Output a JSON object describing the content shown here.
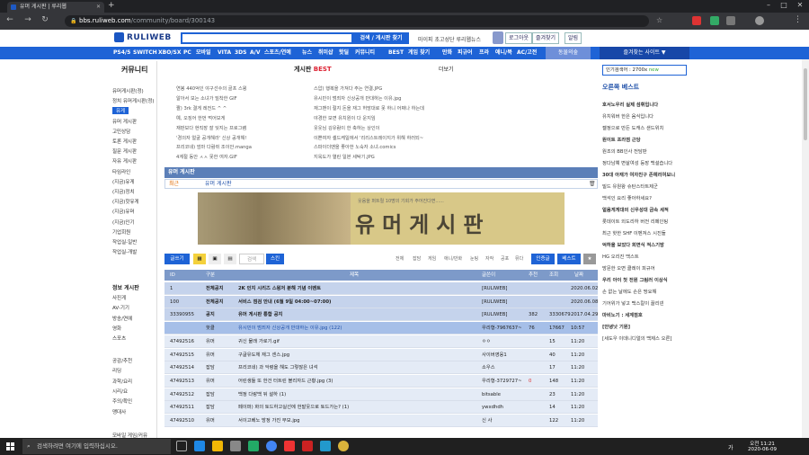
{
  "browser": {
    "tab_title": "유머 게시판 | 루리웹",
    "url_host": "bbs.ruliweb.com",
    "url_path": "/community/board/300143"
  },
  "header": {
    "logo": "RULIWEB",
    "search_button": "검색 / 게시판 찾기",
    "user_links": "마이피  초고성단  루리웹뉴스",
    "login_button": "로그아웃",
    "fav_button": "즐겨찾기",
    "alert_button": "알림"
  },
  "nav": {
    "items": [
      "PS4/5",
      "SWITCH",
      "XBO/SX",
      "PC",
      "모바일",
      "VITA",
      "3DS",
      "A/V",
      "스포츠/연예",
      "뉴스",
      "취미샵",
      "핫딜",
      "커뮤니티",
      "BEST",
      "게임 찾기",
      "만화",
      "피규어",
      "프라",
      "애니/북",
      "AC/고전"
    ],
    "game_button": "동물의숲",
    "fav_site": "즐겨찾는 사이트 ▼"
  },
  "left": {
    "title": "커뮤니티",
    "items": [
      "유머게시판(정)",
      "정치 유머게시판(정)",
      "유게",
      "유머 게시판",
      "고민상담",
      "토론 게시판",
      "질문 게시판",
      "자유 게시판",
      "타임라인",
      "(지금)유게",
      "(지금)정치",
      "(지금)핫유게",
      "(지금)유머",
      "(지금)인기",
      "기업회원",
      "작업실-일반",
      "작업실-개발"
    ],
    "section2": "정보 게시판",
    "items2": [
      "사진게",
      "AV-기기",
      "방송/연예",
      "영화",
      "스포츠"
    ],
    "items3": [
      "공감/추천",
      "리딩",
      "과학/요리",
      "시리/요",
      "주의/확인",
      "맹대사"
    ],
    "bottom": "모바일 게임/커뮤"
  },
  "best": {
    "title_prefix": "게시판",
    "title_best": "BEST",
    "more": "더보기",
    "col1": [
      "연봉 440억인 야구선수의 골프 스윙",
      "알아서 보는 소녀가 밀착한 GIF",
      "짤) 3rk 결게 레전드 ^ ^",
      "예, 오징어 한번 먹어보게",
      "재판보다 현직장 잘 잊지는 프로그램",
      "'경의자 얼굴 공개해라' 신상 공개해!",
      "프리코네) 엄마 다람쥐 조이안.manga",
      "4계절 동안 ㅅㅅ 못한 여자.GIF"
    ],
    "col2": [
      "스압) 행복을 가져다 주는 연결.JPG",
      "유시민이 범죄자 신상공개 반대하는 이유.jpg",
      "재그밴이 절지 돈을 재그 허망대로 못 하니 어쩌나 하는데",
      "야경한 보면 유치원이 다 운지임",
      "웃웃님 김유람이 한 축하는 상인이",
      "이쁜여자 셀드케일에서 '리리스트레이지가 위해 하러되~",
      "스파이더맨을 좋아한 노숙자 소녀.comics",
      "지옥도가 열린 일본 세탁기.JPG"
    ]
  },
  "board": {
    "title": "유머 게시판",
    "recent_label": "최근",
    "recent_item": "유머 게시판",
    "banner_text": "유머게시판",
    "banner_sub": "웃음을 퍼트릴 10명의 기회가 주어진다면......",
    "toolbar": {
      "write": "글쓰기",
      "search_placeholder": "검색",
      "search_btn": "스킨",
      "filters": [
        "전체",
        "잡담",
        "게임",
        "애니/만화",
        "눈팅",
        "자작",
        "공포",
        "뮤다"
      ],
      "hot": "인증글",
      "best": "베스트"
    },
    "columns": [
      "ID",
      "구분",
      "제목",
      "글쓴이",
      "추천",
      "조회",
      "날짜"
    ],
    "rows": [
      {
        "id": "1",
        "cat": "전체공지",
        "title": "2K 인지 시리즈 스윙저 분해 기념 이벤트",
        "author": "[RULIWEB]",
        "rec": "",
        "views": "",
        "date": "2020.06.02",
        "type": "notice"
      },
      {
        "id": "100",
        "cat": "전체공지",
        "title": "서비스 점검 안내 (6월 9일 04:00~07:00)",
        "author": "[RULIWEB]",
        "rec": "",
        "views": "",
        "date": "2020.06.08",
        "type": "notice"
      },
      {
        "id": "33390955",
        "cat": "공지",
        "title": "유머 게시판 통합 공지",
        "author": "[RULIWEB]",
        "rec": "382",
        "views": "3330679",
        "date": "2017.04.29",
        "type": "notice"
      },
      {
        "id": "",
        "cat": "핫클",
        "title": "유시민이 범죄자 신상공개 반대하는 이유.jpg (122)",
        "author": "우리형-7967637~",
        "rec": "76",
        "views": "17667",
        "date": "10:57",
        "type": "hl"
      },
      {
        "id": "47492516",
        "cat": "유머",
        "title": "귀신 물래 가로기.gif",
        "author": "ㅇㅇ",
        "rec": "",
        "views": "15",
        "date": "11:20",
        "type": "normal"
      },
      {
        "id": "47492515",
        "cat": "유머",
        "title": "구글유도체 재그 센스.jpg",
        "author": "사이버영웅1",
        "rec": "",
        "views": "40",
        "date": "11:20",
        "type": "normal"
      },
      {
        "id": "47492514",
        "cat": "잡담",
        "title": "프리코네) 과 악령을 해도 그렇잖은 녀석",
        "author": "소우스",
        "rec": "",
        "views": "17",
        "date": "11:20",
        "type": "normal"
      },
      {
        "id": "47492513",
        "cat": "유머",
        "title": "어린생들 또 한건 터트린 블리자드 근황.jpg (3)",
        "author": "우리형-3729727~",
        "rec": "0",
        "views": "148",
        "date": "11:20",
        "type": "normal"
      },
      {
        "id": "47492512",
        "cat": "잡담",
        "title": "백정 다랑백 뒤 설하 (1)",
        "author": "bitsable",
        "rec": "",
        "views": "23",
        "date": "11:20",
        "type": "normal"
      },
      {
        "id": "47492511",
        "cat": "잡담",
        "title": "페이퍼) 화의 토드하고실선에 헌발웃으로 토드가는? (1)",
        "author": "ywxdhdh",
        "rec": "",
        "views": "14",
        "date": "11:20",
        "type": "normal"
      },
      {
        "id": "47492510",
        "cat": "유머",
        "title": "서이고베노 방정 가진 무모.jpg",
        "author": "신 사",
        "rec": "",
        "views": "122",
        "date": "11:20",
        "type": "normal"
      }
    ]
  },
  "right": {
    "hot_label": "인기검색어 : 2700x",
    "hot_new": "new",
    "best_title": "오른쪽 베스트",
    "items": [
      {
        "t": "호서노우리 실제 섬휘입니다",
        "b": true
      },
      {
        "t": "유치워버 한은 음식입니다",
        "b": false
      },
      {
        "t": "젤정으로 만든 도캐스 샌드위치",
        "b": false
      },
      {
        "t": "원이트 프라점 근당",
        "b": true
      },
      {
        "t": "원조의 BB인사 전담판",
        "b": false
      },
      {
        "t": "정다남예 변살여성 등장 백설습니다",
        "b": false
      },
      {
        "t": "30대 아재가 여자친구 존예리여보니",
        "b": true
      },
      {
        "t": "빌드 유원왕 슈탄스타트제군",
        "b": false
      },
      {
        "t": "백석인 요리 좋아하세요?",
        "b": false
      },
      {
        "t": "얼음게게대의 신우성대 금속 세적",
        "b": true
      },
      {
        "t": "롯데이트 외도리하 버전 리페인팅",
        "b": false
      },
      {
        "t": "최근 핫한 SHF 이벤져스 시진들",
        "b": false
      },
      {
        "t": "억하을 보았다 회면식 적스기방",
        "b": true
      },
      {
        "t": "HG 오리진 백스트",
        "b": false
      },
      {
        "t": "방문한 오면 클레이 피규어",
        "b": false
      },
      {
        "t": "우리 아이 첫 전원 그림러 이상식",
        "b": true
      },
      {
        "t": "손 없는 날에도 손은 땅요해",
        "b": false
      },
      {
        "t": "기어위가 넣고 백스칼이 끌리넨",
        "b": false
      },
      {
        "t": "마비노기 : 세계점호",
        "b": true
      },
      {
        "t": "[안녕낫 기원]",
        "b": true
      },
      {
        "t": "[세도우 이데니디얼의 백제스 오른]",
        "b": false
      }
    ]
  },
  "taskbar": {
    "search_placeholder": "검색하려면 여기에 입력하십시오.",
    "lang": "가",
    "time": "오전 11:21",
    "date": "2020-06-09"
  },
  "colors": {
    "accent": "#1e63d6",
    "header_dark": "#1747a8"
  }
}
